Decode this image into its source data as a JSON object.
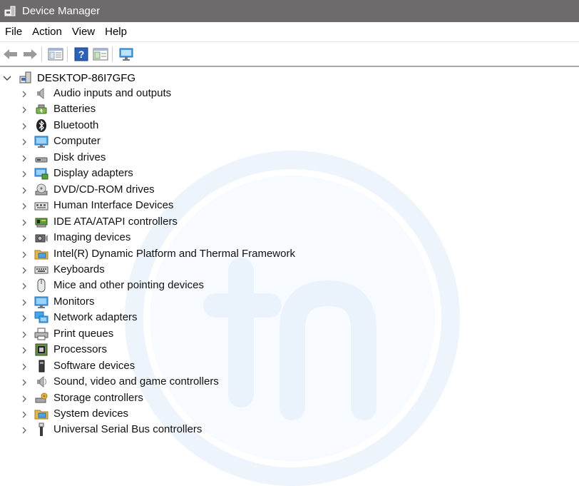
{
  "window": {
    "title": "Device Manager"
  },
  "menu": [
    "File",
    "Action",
    "View",
    "Help"
  ],
  "toolbar": [
    "back-icon",
    "forward-icon",
    "properties-icon",
    "help-icon",
    "show-hidden-icon",
    "scan-hardware-icon"
  ],
  "tree": {
    "root": "DESKTOP-86I7GFG",
    "categories": [
      {
        "label": "Audio inputs and outputs",
        "icon": "speaker-icon"
      },
      {
        "label": "Batteries",
        "icon": "battery-icon"
      },
      {
        "label": "Bluetooth",
        "icon": "bluetooth-icon"
      },
      {
        "label": "Computer",
        "icon": "monitor-icon"
      },
      {
        "label": "Disk drives",
        "icon": "disk-drive-icon"
      },
      {
        "label": "Display adapters",
        "icon": "display-adapter-icon"
      },
      {
        "label": "DVD/CD-ROM drives",
        "icon": "dvd-drive-icon"
      },
      {
        "label": "Human Interface Devices",
        "icon": "hid-icon"
      },
      {
        "label": "IDE ATA/ATAPI controllers",
        "icon": "ide-controller-icon"
      },
      {
        "label": "Imaging devices",
        "icon": "camera-icon"
      },
      {
        "label": "Intel(R) Dynamic Platform and Thermal Framework",
        "icon": "folder-icon"
      },
      {
        "label": "Keyboards",
        "icon": "keyboard-icon"
      },
      {
        "label": "Mice and other pointing devices",
        "icon": "mouse-icon"
      },
      {
        "label": "Monitors",
        "icon": "monitor-icon"
      },
      {
        "label": "Network adapters",
        "icon": "network-icon"
      },
      {
        "label": "Print queues",
        "icon": "printer-icon"
      },
      {
        "label": "Processors",
        "icon": "processor-icon"
      },
      {
        "label": "Software devices",
        "icon": "software-device-icon"
      },
      {
        "label": "Sound, video and game controllers",
        "icon": "sound-icon"
      },
      {
        "label": "Storage controllers",
        "icon": "storage-icon"
      },
      {
        "label": "System devices",
        "icon": "folder-icon"
      },
      {
        "label": "Universal Serial Bus controllers",
        "icon": "usb-icon"
      }
    ]
  },
  "colors": {
    "titlebar": "#6d6b6b",
    "icon_blue": "#2f88d6",
    "watermark": "#eef4fb"
  }
}
